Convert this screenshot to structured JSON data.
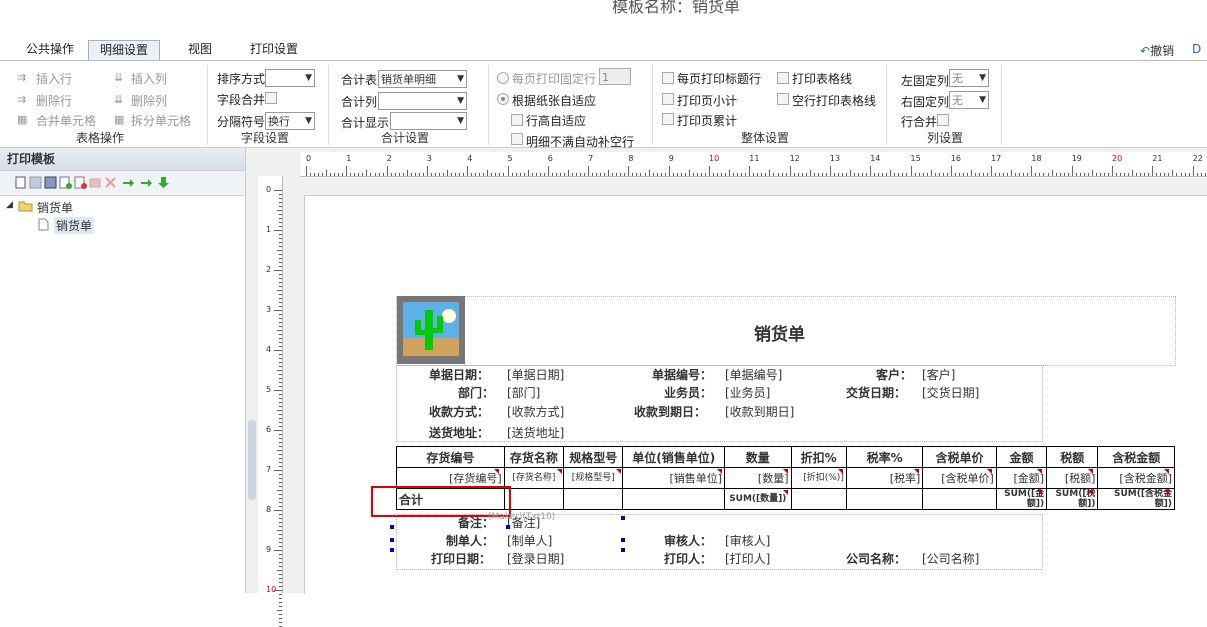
{
  "title": "模板名称：销货单",
  "tabs": [
    {
      "label": "公共操作"
    },
    {
      "label": "明细设置"
    },
    {
      "label": "视图"
    },
    {
      "label": "打印设置"
    }
  ],
  "topright": {
    "undo": "撤销",
    "redo": "D"
  },
  "ribbon": {
    "table_ops": {
      "insert_row": "插入行",
      "insert_col": "插入列",
      "delete_row": "删除行",
      "delete_col": "删除列",
      "merge_cells": "合并单元格",
      "split_cells": "拆分单元格",
      "group": "表格操作"
    },
    "field_settings": {
      "sort_label": "排序方式",
      "sort_value": "",
      "merge_label": "字段合并",
      "sep_label": "分隔符号",
      "sep_value": "换行",
      "group": "字段设置"
    },
    "total_settings": {
      "table_label": "合计表",
      "table_value": "销货单明细",
      "col_label": "合计列",
      "col_value": "",
      "display_label": "合计显示",
      "display_value": "",
      "group": "合计设置"
    },
    "row_settings": {
      "fixed_rows_label": "每页打印固定行",
      "fixed_rows_value": "1",
      "auto_fit_label": "根据纸张自适应",
      "row_height_label": "行高自适应",
      "fill_rows_label": "明细不满自动补空行"
    },
    "overall": {
      "title_row": "每页打印标题行",
      "grid_lines": "打印表格线",
      "subtotal": "打印页小计",
      "blank_grid": "空行打印表格线",
      "accumulate": "打印页累计",
      "group": "整体设置"
    },
    "col_settings": {
      "left_fixed_label": "左固定列",
      "left_fixed_value": "无",
      "right_fixed_label": "右固定列",
      "right_fixed_value": "无",
      "row_merge_label": "行合并",
      "group": "列设置"
    }
  },
  "left_panel": {
    "header": "打印模板",
    "tree_root": "销货单",
    "tree_child": "销货单"
  },
  "ruler": {
    "h": [
      "0",
      "1",
      "2",
      "3",
      "4",
      "5",
      "6",
      "7",
      "8",
      "9",
      "10",
      "11",
      "12",
      "13",
      "14",
      "15",
      "16",
      "17",
      "18",
      "19",
      "20",
      "21",
      "22"
    ],
    "v": [
      "0",
      "1",
      "2",
      "3",
      "4",
      "5",
      "6",
      "7",
      "8",
      "9",
      "10"
    ]
  },
  "report": {
    "title": "销货单",
    "header_fields": [
      {
        "label": "单据日期：",
        "value": "[单据日期]"
      },
      {
        "label": "单据编号：",
        "value": "[单据编号]"
      },
      {
        "label": "客户：",
        "value": "[客户]"
      },
      {
        "label": "部门：",
        "value": "[部门]"
      },
      {
        "label": "业务员：",
        "value": "[业务员]"
      },
      {
        "label": "交货日期：",
        "value": "[交货日期]"
      },
      {
        "label": "收款方式：",
        "value": "[收款方式]"
      },
      {
        "label": "收款到期日：",
        "value": "[收款到期日]"
      },
      {
        "label": "送货地址：",
        "value": "[送货地址]"
      }
    ],
    "columns": [
      "存货编号",
      "存货名称",
      "规格型号",
      "单位(销售单位)",
      "数量",
      "折扣%",
      "税率%",
      "含税单价",
      "金额",
      "税额",
      "含税金额"
    ],
    "detail_row": [
      "[存货编号]",
      "[存货名称]",
      "[规格型号]",
      "[销售单位]",
      "[数量]",
      "[折扣(%)]",
      "[税率]",
      "[含税单价]",
      "[金额]",
      "[税额]",
      "[含税金额]"
    ],
    "total_row": {
      "label": "合计",
      "qty": "SUM([数量])",
      "amount": "SUM([金额])",
      "tax": "SUM([税额])",
      "total": "SUM([含税金额])"
    },
    "footer_fields": [
      {
        "label": "备注：",
        "value": "[备注]"
      },
      {
        "label": "制单人：",
        "value": "[制单人]"
      },
      {
        "label": "审核人：",
        "value": "[审核人]"
      },
      {
        "label": "打印日期：",
        "value": "[登录日期]"
      },
      {
        "label": "打印人：",
        "value": "[打印人]"
      },
      {
        "label": "公司名称：",
        "value": "[公司名称]"
      }
    ],
    "overlay_text": "(Maker)(Txt10)"
  },
  "colors": {
    "highlight": "#e00000",
    "accent": "#d00000"
  }
}
